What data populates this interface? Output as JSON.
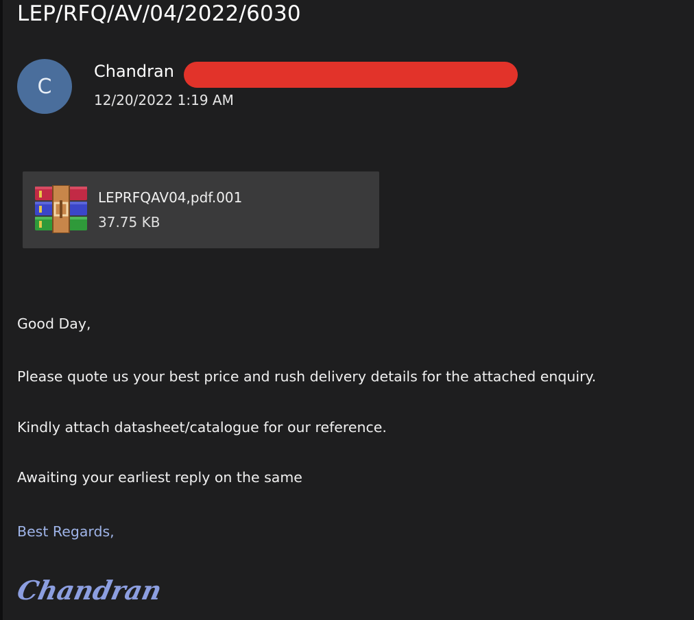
{
  "email": {
    "subject": "LEP/RFQ/AV/04/2022/6030",
    "sender": {
      "avatar_initial": "C",
      "name": "Chandran",
      "timestamp": "12/20/2022 1:19 AM"
    },
    "attachment": {
      "icon": "winrar-archive-icon",
      "filename": "LEPRFQAV04,pdf.001",
      "size": "37.75 KB"
    },
    "body": {
      "greeting": "Good Day,",
      "line1": "Please quote us your best price and rush delivery details for the attached enquiry.",
      "line2": "Kindly attach datasheet/catalogue for our reference.",
      "line3": "Awaiting your earliest reply on the same",
      "closing": "Best Regards,",
      "signature": "Chandran"
    }
  },
  "colors": {
    "background": "#1e1e1f",
    "avatar": "#4a6e9c",
    "redaction": "#e2332a",
    "attachment_card": "#3a3a3b",
    "closing_text": "#9fb4e8",
    "signature": "#8c9ee0"
  }
}
